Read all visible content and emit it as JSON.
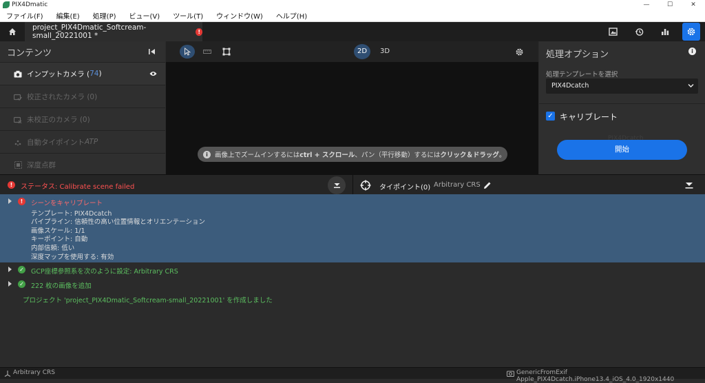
{
  "window": {
    "title": "PIX4Dmatic",
    "controls": [
      "—",
      "☐",
      "✕"
    ]
  },
  "menu": [
    "ファイル(F)",
    "編集(E)",
    "処理(P)",
    "ビュー(V)",
    "ツール(T)",
    "ウィンドウ(W)",
    "ヘルプ(H)"
  ],
  "tab": {
    "project_name": "project_PIX4Dmatic_Softcream-small_20221001 *",
    "error_mark": "!"
  },
  "left_panel": {
    "title": "コンテンツ",
    "input_camera_label": "インプットカメラ (",
    "input_camera_count": "74",
    "input_camera_close": ")",
    "calibrated": "校正されたカメラ (0)",
    "uncalibrated": "未校正のカメラ (0)",
    "autotie_prefix": "自動タイポイント ",
    "autotie_suffix": "ATP",
    "depth": "深度点群"
  },
  "viewport": {
    "mode_2d": "2D",
    "mode_3d": "3D",
    "hint_prefix": "画像上でズームインするには",
    "hint_bold1": "ctrl + スクロール",
    "hint_mid": "、パン（平行移動）するには",
    "hint_bold2": "クリック＆ドラッグ",
    "hint_end": "。",
    "info_mark": "i"
  },
  "right_panel": {
    "title": "処理オプション",
    "info_mark": "i",
    "template_label": "処理テンプレートを選択",
    "template_value": "PIX4Dcatch",
    "calibrate_label": "キャリブレート",
    "faded_value": "PIX4Dcatch",
    "start_button": "開始"
  },
  "status": {
    "error_mark": "!",
    "text": "ステータス: Calibrate scene failed",
    "tiepoint_label": "タイポイント(0)",
    "tiepoint_crs": "Arbitrary CRS"
  },
  "log": {
    "entry1_title": "シーンをキャリブレート",
    "entry1_details": [
      "テンプレート: PIX4Dcatch",
      "パイプライン: 信頼性の高い位置情報とオリエンテーション",
      "画像スケール: 1/1",
      "キーポイント: 自動",
      "内部信頼: 低い",
      "深度マップを使用する: 有効"
    ],
    "entry2": "GCP座標参照系を次のように設定: Arbitrary CRS",
    "entry3": "222 枚の画像を追加",
    "entry4": "プロジェクト 'project_PIX4Dmatic_Softcream-small_20221001' を作成しました",
    "ok_mark": "✓"
  },
  "bottom": {
    "crs": "Arbitrary CRS",
    "camera": "GenericFromExif Apple_PIX4Dcatch.iPhone13.4_iOS_4.0_1920x1440"
  },
  "colors": {
    "accent": "#1a73e8",
    "error": "#e53935",
    "ok": "#43a047",
    "selection": "#3c5c7c"
  }
}
